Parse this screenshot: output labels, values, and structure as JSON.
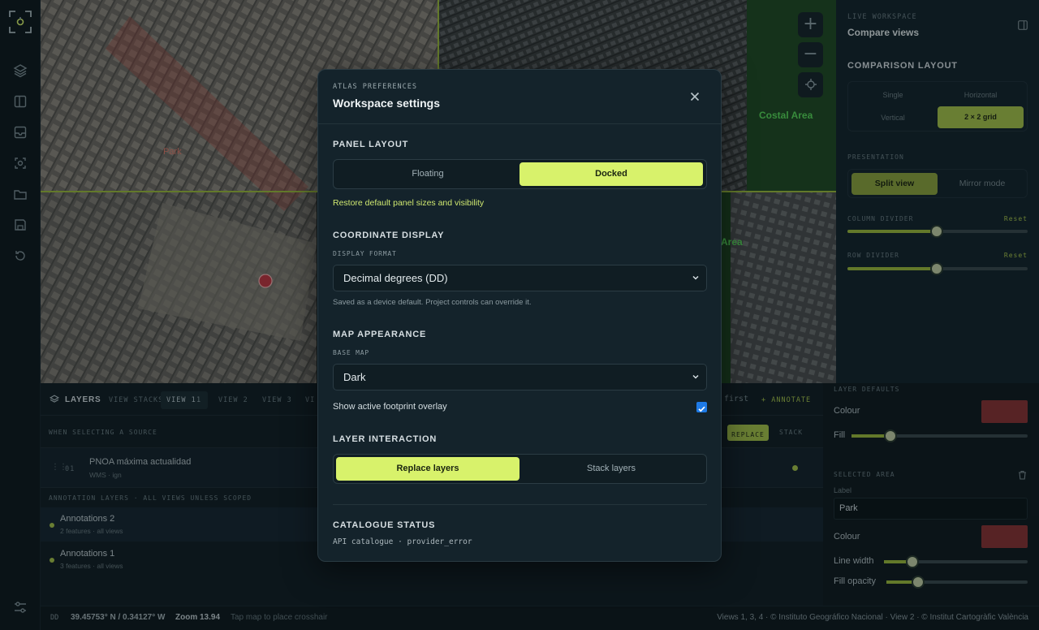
{
  "map": {
    "labels": {
      "park": "Park",
      "costal_area": "Costal Area",
      "area": "Area"
    },
    "zoom_in": "+",
    "zoom_out": "−"
  },
  "right_panel": {
    "eyebrow": "LIVE WORKSPACE",
    "title": "Compare views",
    "layout_heading": "COMPARISON LAYOUT",
    "layout_options": [
      "Single",
      "Horizontal",
      "Vertical",
      "2 × 2 grid"
    ],
    "layout_selected": "2 × 2 grid",
    "presentation_label": "PRESENTATION",
    "presentation_options": [
      "Split view",
      "Mirror mode"
    ],
    "column_divider_label": "COLUMN DIVIDER",
    "column_divider_reset": "Reset",
    "column_divider_value": 0.5,
    "row_divider_label": "ROW DIVIDER",
    "row_divider_reset": "Reset",
    "row_divider_value": 0.5
  },
  "right_panel_lower": {
    "layer_defaults": "LAYER DEFAULTS",
    "colour_label": "Colour",
    "fill_label": "Fill",
    "fill_value": 0.22,
    "selected_area": "SELECTED AREA",
    "label_caption": "Label",
    "label_value": "Park",
    "colour2_label": "Colour",
    "line_width_label": "Line width",
    "line_width_value": 0.2,
    "fill_opacity_label": "Fill opacity",
    "fill_opacity_value": 0.22,
    "swatch_color": "#b13a3a"
  },
  "layers": {
    "title": "LAYERS",
    "tabs": [
      "VIEW STACKS",
      "VIEW 1",
      "VIEW 2",
      "VIEW 3",
      "VI"
    ],
    "tab_count": "1",
    "first": "first",
    "annotate": "+ ANNOTATE",
    "selecting_caption": "WHEN SELECTING A SOURCE",
    "replace_label": "REPLACE",
    "stack_label": "STACK",
    "source_index": "01",
    "source_name": "PNOA máxima actualidad",
    "source_sub": "WMS · ign",
    "annotation_caption": "ANNOTATION LAYERS · ALL VIEWS UNLESS SCOPED",
    "annotations": [
      {
        "name": "Annotations 2",
        "meta": "2 features · all views"
      },
      {
        "name": "Annotations 1",
        "meta": "3 features · all views"
      }
    ]
  },
  "status": {
    "format": "DD",
    "coords": "39.45753° N / 0.34127° W",
    "zoom": "Zoom 13.94",
    "hint": "Tap map to place crosshair",
    "attribution": "Views 1, 3, 4 · © Instituto Geográfico Nacional · View 2 · © Institut Cartogràfic València"
  },
  "modal": {
    "eyebrow": "ATLAS PREFERENCES",
    "title": "Workspace settings",
    "panel_layout": {
      "heading": "PANEL LAYOUT",
      "options": [
        "Floating",
        "Docked"
      ],
      "selected": "Docked",
      "restore_link": "Restore default panel sizes and visibility"
    },
    "coordinate_display": {
      "heading": "COORDINATE DISPLAY",
      "sub": "DISPLAY FORMAT",
      "value": "Decimal degrees (DD)",
      "help": "Saved as a device default. Project controls can override it."
    },
    "map_appearance": {
      "heading": "MAP APPEARANCE",
      "sub": "BASE MAP",
      "value": "Dark",
      "footprint_label": "Show active footprint overlay",
      "footprint_checked": true
    },
    "layer_interaction": {
      "heading": "LAYER INTERACTION",
      "options": [
        "Replace layers",
        "Stack layers"
      ],
      "selected": "Replace layers"
    },
    "catalogue_status": {
      "heading": "CATALOGUE STATUS",
      "value": "API catalogue · provider_error"
    }
  },
  "colors": {
    "accent": "#d8f26b",
    "marker": "#c0343f"
  }
}
